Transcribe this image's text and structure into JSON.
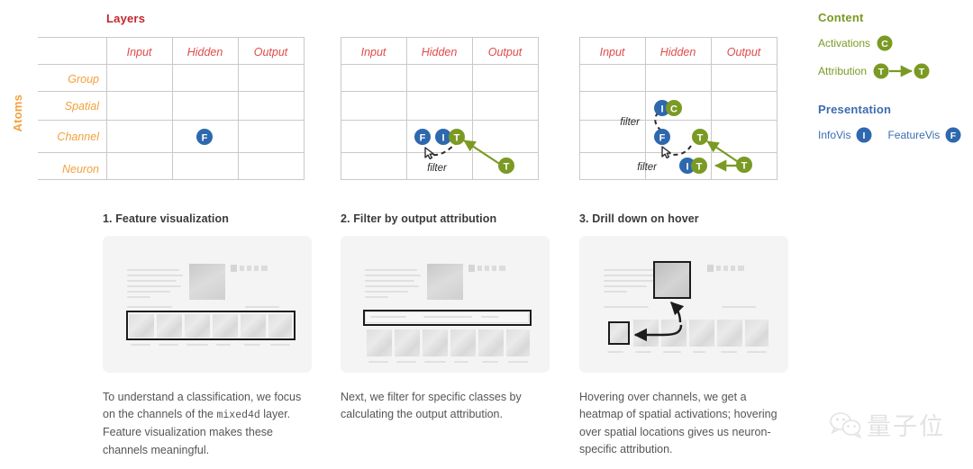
{
  "matrix": {
    "title": "Layers",
    "axis_label_rows": "Atoms",
    "columns": [
      "Input",
      "Hidden",
      "Output"
    ],
    "rows": [
      "Group",
      "Spatial",
      "Channel",
      "Neuron"
    ],
    "filter_label": "filter"
  },
  "legend": {
    "content_heading": "Content",
    "content_color": "#7A9A24",
    "presentation_heading": "Presentation",
    "presentation_color": "#3C6CB0",
    "items": [
      {
        "label": "Activations",
        "badge": "C"
      },
      {
        "label": "Attribution",
        "badge": "T",
        "badge2": "T"
      },
      {
        "label": "InfoVis",
        "badge": "I"
      },
      {
        "label": "FeatureVis",
        "badge": "F"
      }
    ]
  },
  "badges": {
    "blue": "#2E68AE",
    "green": "#7A9A24",
    "F": "F",
    "I": "I",
    "T": "T",
    "C": "C"
  },
  "panels": [
    {
      "title": "1. Feature visualization",
      "caption_a": "To understand a classification, we focus on the channels of the ",
      "caption_mono": "mixed4d",
      "caption_b": " layer. Feature visualization makes these channels meaningful."
    },
    {
      "title": "2. Filter by output attribution",
      "caption_a": "Next, we filter for specific classes by calculating the output attribution.",
      "caption_mono": "",
      "caption_b": ""
    },
    {
      "title": "3. Drill down on hover",
      "caption_a": "Hovering over channels, we get a heatmap of spatial activations; hovering over spatial locations gives us neuron-specific attribution.",
      "caption_mono": "",
      "caption_b": ""
    }
  ],
  "watermark": {
    "text": "量子位"
  }
}
